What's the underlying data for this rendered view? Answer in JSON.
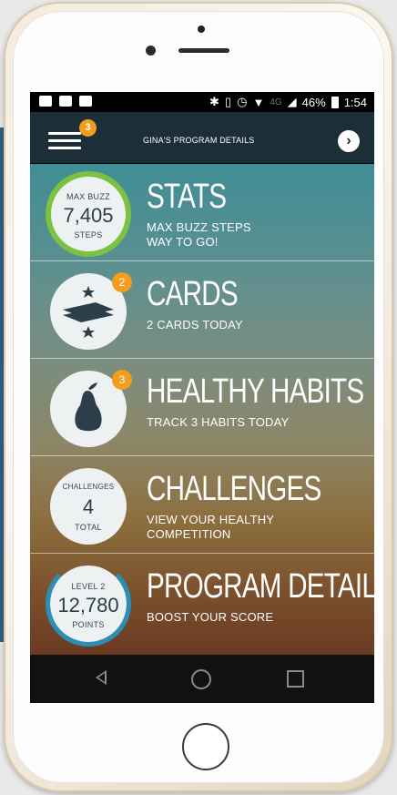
{
  "status_bar": {
    "network": "4G",
    "battery": "46%",
    "time": "1:54"
  },
  "header": {
    "menu_badge": "3",
    "title": "GINA'S PROGRAM DETAILS",
    "next_icon": "chevron-right-icon"
  },
  "rows": [
    {
      "circle_top": "MAX BUZZ",
      "circle_value": "7,405",
      "circle_bottom": "STEPS",
      "title": "STATS",
      "subtitle_line1": "MAX BUZZ STEPS",
      "subtitle_line2": "WAY TO GO!",
      "badge": ""
    },
    {
      "title": "CARDS",
      "subtitle_line1": "2 CARDS TODAY",
      "badge": "2",
      "icon": "cards-icon"
    },
    {
      "title": "HEALTHY HABITS",
      "subtitle_line1": "TRACK 3 HABITS TODAY",
      "badge": "3",
      "icon": "pear-icon"
    },
    {
      "circle_top": "CHALLENGES",
      "circle_value": "4",
      "circle_bottom": "TOTAL",
      "title": "CHALLENGES",
      "subtitle_line1": "VIEW YOUR HEALTHY",
      "subtitle_line2": "COMPETITION"
    },
    {
      "circle_top": "LEVEL 2",
      "circle_value": "12,780",
      "circle_bottom": "POINTS",
      "title": "PROGRAM DETAILS",
      "subtitle_line1": "BOOST YOUR SCORE"
    }
  ],
  "colors": {
    "accent": "#f39c1e",
    "header_bg": "#1c2f39",
    "steps_ring": "#7bc142",
    "points_ring": "#2a8fb8"
  }
}
